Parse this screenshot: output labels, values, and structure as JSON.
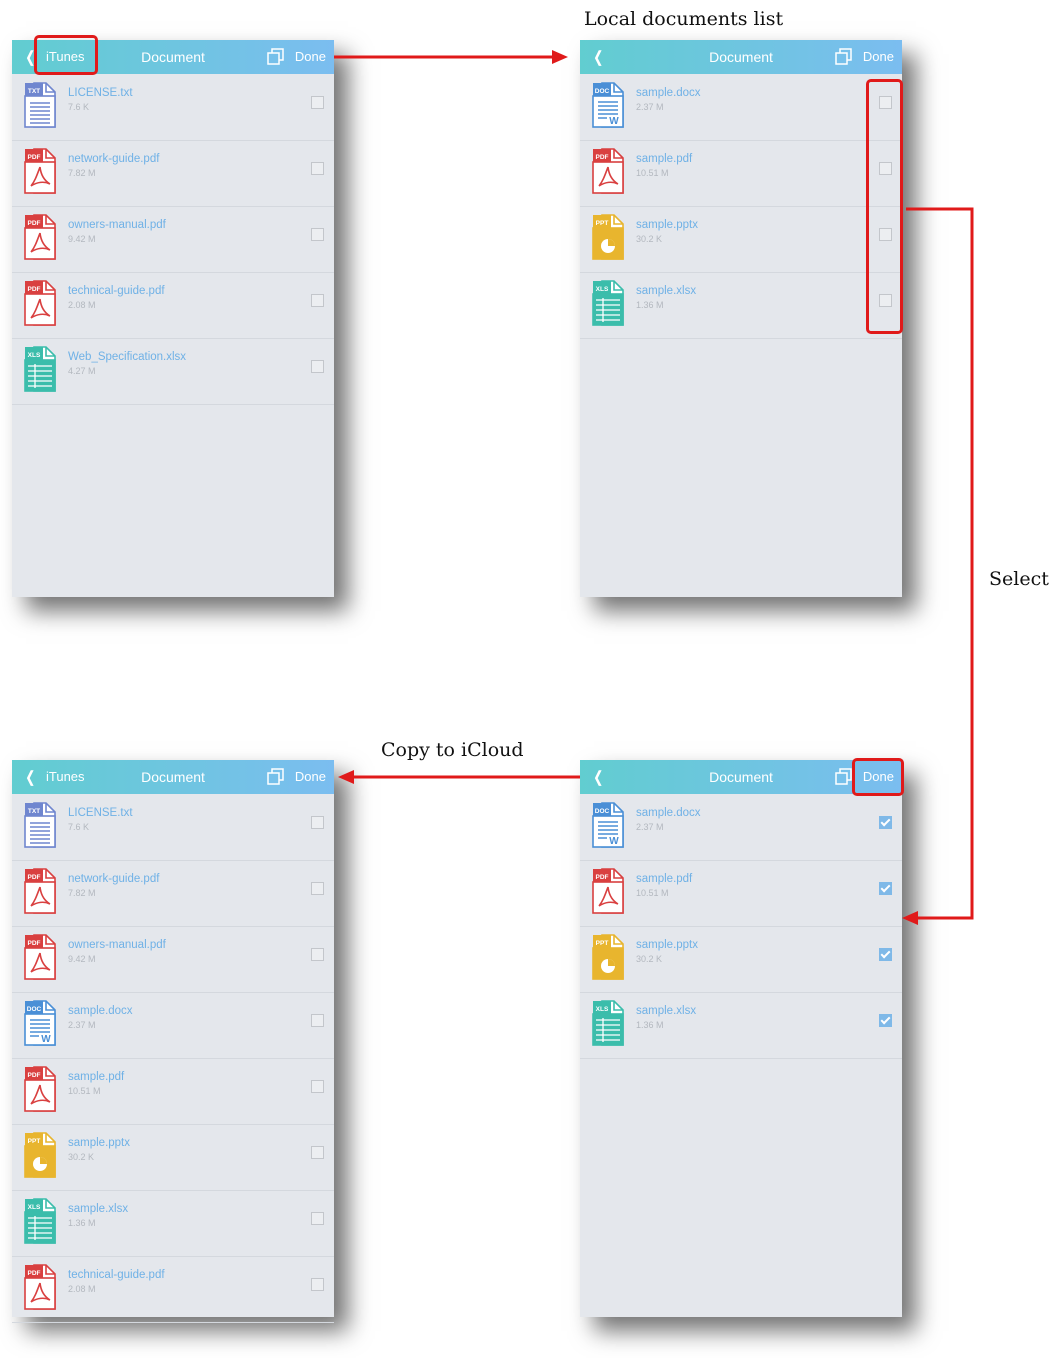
{
  "annotations": {
    "local_list": "Local documents list",
    "select": "Select",
    "copy_icloud": "Copy to iCloud"
  },
  "colors": {
    "highlight": "#e01a1a",
    "nav_gradient_start": "#61cdd0",
    "nav_gradient_end": "#7bbdf0",
    "pdf": "#d94040",
    "doc": "#4a8fd6",
    "txt": "#6f86cf",
    "ppt": "#e8b52e",
    "xls": "#3bbdab"
  },
  "panels": [
    {
      "id": "icloud-before",
      "back_label": "iTunes",
      "title": "Document",
      "done_label": "Done",
      "files": [
        {
          "name": "LICENSE.txt",
          "size": "7.6 K",
          "type": "txt",
          "tag": "TXT",
          "checked": false
        },
        {
          "name": "network-guide.pdf",
          "size": "7.82 M",
          "type": "pdf",
          "tag": "PDF",
          "checked": false
        },
        {
          "name": "owners-manual.pdf",
          "size": "9.42 M",
          "type": "pdf",
          "tag": "PDF",
          "checked": false
        },
        {
          "name": "technical-guide.pdf",
          "size": "2.08 M",
          "type": "pdf",
          "tag": "PDF",
          "checked": false
        },
        {
          "name": "Web_Specification.xlsx",
          "size": "4.27 M",
          "type": "xls",
          "tag": "XLS",
          "checked": false
        }
      ]
    },
    {
      "id": "local-list",
      "back_label": "",
      "title": "Document",
      "done_label": "Done",
      "files": [
        {
          "name": "sample.docx",
          "size": "2.37 M",
          "type": "doc",
          "tag": "DOC",
          "checked": false
        },
        {
          "name": "sample.pdf",
          "size": "10.51 M",
          "type": "pdf",
          "tag": "PDF",
          "checked": false
        },
        {
          "name": "sample.pptx",
          "size": "30.2 K",
          "type": "ppt",
          "tag": "PPT",
          "checked": false
        },
        {
          "name": "sample.xlsx",
          "size": "1.36 M",
          "type": "xls",
          "tag": "XLS",
          "checked": false
        }
      ]
    },
    {
      "id": "icloud-after",
      "back_label": "iTunes",
      "title": "Document",
      "done_label": "Done",
      "files": [
        {
          "name": "LICENSE.txt",
          "size": "7.6 K",
          "type": "txt",
          "tag": "TXT",
          "checked": false
        },
        {
          "name": "network-guide.pdf",
          "size": "7.82 M",
          "type": "pdf",
          "tag": "PDF",
          "checked": false
        },
        {
          "name": "owners-manual.pdf",
          "size": "9.42 M",
          "type": "pdf",
          "tag": "PDF",
          "checked": false
        },
        {
          "name": "sample.docx",
          "size": "2.37 M",
          "type": "doc",
          "tag": "DOC",
          "checked": false
        },
        {
          "name": "sample.pdf",
          "size": "10.51 M",
          "type": "pdf",
          "tag": "PDF",
          "checked": false
        },
        {
          "name": "sample.pptx",
          "size": "30.2 K",
          "type": "ppt",
          "tag": "PPT",
          "checked": false
        },
        {
          "name": "sample.xlsx",
          "size": "1.36 M",
          "type": "xls",
          "tag": "XLS",
          "checked": false
        },
        {
          "name": "technical-guide.pdf",
          "size": "2.08 M",
          "type": "pdf",
          "tag": "PDF",
          "checked": false
        }
      ]
    },
    {
      "id": "local-selected",
      "back_label": "",
      "title": "Document",
      "done_label": "Done",
      "files": [
        {
          "name": "sample.docx",
          "size": "2.37 M",
          "type": "doc",
          "tag": "DOC",
          "checked": true
        },
        {
          "name": "sample.pdf",
          "size": "10.51 M",
          "type": "pdf",
          "tag": "PDF",
          "checked": true
        },
        {
          "name": "sample.pptx",
          "size": "30.2 K",
          "type": "ppt",
          "tag": "PPT",
          "checked": true
        },
        {
          "name": "sample.xlsx",
          "size": "1.36 M",
          "type": "xls",
          "tag": "XLS",
          "checked": true
        }
      ]
    }
  ]
}
